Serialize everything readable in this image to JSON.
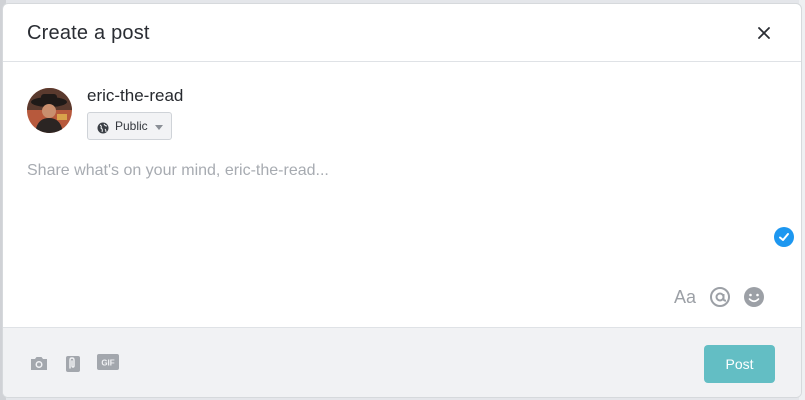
{
  "modal": {
    "title": "Create a post",
    "close_icon": "close-icon"
  },
  "author": {
    "username": "eric-the-read",
    "avatar_icon": "avatar"
  },
  "privacy": {
    "selected": "Public",
    "icon": "globe-icon"
  },
  "composer": {
    "value": "",
    "placeholder": "Share what's on your mind, eric-the-read..."
  },
  "formatting": {
    "text_format_label": "Aa",
    "mention_icon": "at-icon",
    "emoji_icon": "emoji-icon",
    "check_icon": "checkmark-icon"
  },
  "footer": {
    "icons": [
      "camera-icon",
      "attachment-icon",
      "gif-icon"
    ],
    "gif_label": "GIF",
    "post_label": "Post"
  },
  "colors": {
    "accent": "#63bec4",
    "check_blue": "#1d97f0"
  }
}
